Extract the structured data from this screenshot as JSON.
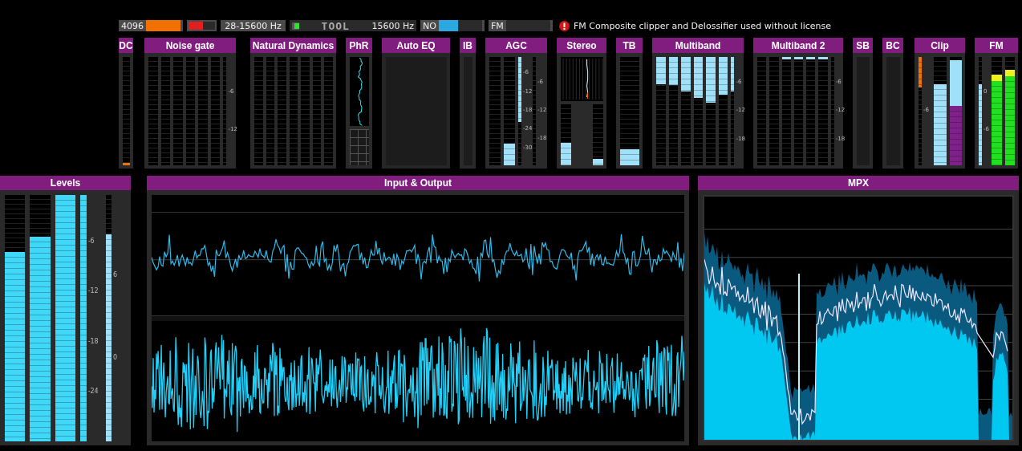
{
  "top_bar": [
    {
      "kind": "meter",
      "text": "4096",
      "level": 1.0,
      "color": "#f07000"
    },
    {
      "kind": "meter",
      "level": 0.55,
      "color": "#e02020"
    },
    {
      "kind": "field",
      "text": "28-15600 Hz"
    },
    {
      "kind": "logo",
      "text": "TOOL",
      "value": "15600 Hz"
    },
    {
      "kind": "meter",
      "text": "NO",
      "level": 0.45,
      "color": "#2aa8e0"
    },
    {
      "kind": "meter",
      "text": "FM"
    },
    {
      "kind": "warning",
      "text": "FM Composite clipper and Delossifier used without license"
    }
  ],
  "modules": [
    {
      "title": "DC",
      "meters": [
        {
          "level": 0.02,
          "color": "#f07000"
        }
      ]
    },
    {
      "title": "Noise gate",
      "meters": [
        {
          "kind": "empty"
        },
        {
          "kind": "empty"
        },
        {
          "kind": "empty"
        },
        {
          "kind": "empty"
        },
        {
          "kind": "empty"
        },
        {
          "kind": "empty"
        },
        {
          "kind": "empty",
          "scale": [
            "-6",
            "-12"
          ]
        }
      ]
    },
    {
      "title": "Natural Dynamics",
      "meters": [
        {
          "kind": "empty"
        },
        {
          "kind": "empty"
        },
        {
          "kind": "empty"
        },
        {
          "kind": "empty"
        },
        {
          "kind": "empty"
        },
        {
          "kind": "empty"
        },
        {
          "kind": "empty"
        }
      ]
    },
    {
      "title": "PhR",
      "kind": "phase"
    },
    {
      "title": "Auto EQ"
    },
    {
      "title": "IB"
    },
    {
      "title": "AGC",
      "meters": [
        {
          "kind": "empty"
        },
        {
          "level": 0.2,
          "color": "#a0e0f8"
        },
        {
          "kind": "gr",
          "level": 0.6,
          "color": "#a0e0f8",
          "scale": [
            "-6",
            "-12",
            "-18",
            "-24",
            "-30"
          ]
        },
        {
          "kind": "empty",
          "scale": [
            "-6",
            "-12",
            "-18"
          ]
        }
      ]
    },
    {
      "title": "Stereo",
      "kind": "stereo",
      "meters": [
        {
          "level": 0.37,
          "color": "#a0e0f8"
        },
        {
          "level": 0.1,
          "color": "#a0e0f8"
        }
      ]
    },
    {
      "title": "TB",
      "meters": [
        {
          "level": 0.15,
          "color": "#a0e0f8"
        }
      ]
    },
    {
      "title": "Multiband",
      "meters": [
        {
          "kind": "gr",
          "level": 0.25,
          "color": "#a0e0f8"
        },
        {
          "kind": "gr",
          "level": 0.26,
          "color": "#a0e0f8"
        },
        {
          "kind": "gr",
          "level": 0.32,
          "color": "#a0e0f8"
        },
        {
          "kind": "gr",
          "level": 0.38,
          "color": "#a0e0f8"
        },
        {
          "kind": "gr",
          "level": 0.42,
          "color": "#a0e0f8"
        },
        {
          "kind": "gr",
          "level": 0.35,
          "color": "#a0e0f8"
        },
        {
          "kind": "gr",
          "level": 0.32,
          "color": "#a0e0f8",
          "scale": [
            "-6",
            "-12",
            "-18"
          ]
        }
      ]
    },
    {
      "title": "Multiband 2",
      "meters": [
        {
          "kind": "empty"
        },
        {
          "kind": "empty"
        },
        {
          "kind": "gr",
          "level": 0.02,
          "color": "#a0e0f8"
        },
        {
          "kind": "gr",
          "level": 0.02,
          "color": "#a0e0f8"
        },
        {
          "kind": "gr",
          "level": 0.02,
          "color": "#a0e0f8"
        },
        {
          "kind": "gr",
          "level": 0.02,
          "color": "#a0e0f8"
        },
        {
          "kind": "empty",
          "scale": [
            "-6",
            "-12",
            "-18"
          ]
        }
      ]
    },
    {
      "title": "SB"
    },
    {
      "title": "BC"
    },
    {
      "title": "Clip",
      "meters": [
        {
          "kind": "gr",
          "level": 0.28,
          "color": "#f07000",
          "scale": [
            "-6"
          ]
        },
        {
          "level": 0.75,
          "color": "#a0e0f8"
        },
        {
          "kind": "split",
          "level": 0.55,
          "color": "#80208a"
        }
      ]
    },
    {
      "title": "FM",
      "meters": [
        {
          "level": 0.75,
          "color": "#a0e0f8",
          "scale": [
            "0",
            "-6"
          ]
        },
        {
          "kind": "fm",
          "level": 0.78,
          "color": "#20e020"
        },
        {
          "kind": "fm",
          "level": 0.82,
          "color": "#20e020"
        }
      ]
    }
  ],
  "panels": [
    {
      "title": "Levels",
      "meters": [
        {
          "level": 0.77,
          "color": "#40d8f8"
        },
        {
          "level": 0.83,
          "color": "#40d8f8"
        },
        {
          "level": 1.0,
          "color": "#40d8f8"
        },
        {
          "level": 1.0,
          "color": "#40d8f8",
          "scale": [
            "-6",
            "-12",
            "-18",
            "-24"
          ]
        },
        {
          "level": 0.84,
          "color": "#a0e0f8",
          "scale": [
            "6",
            "0"
          ]
        }
      ]
    },
    {
      "title": "Input & Output",
      "kind": "waveform"
    },
    {
      "title": "MPX",
      "kind": "spectrum"
    }
  ]
}
